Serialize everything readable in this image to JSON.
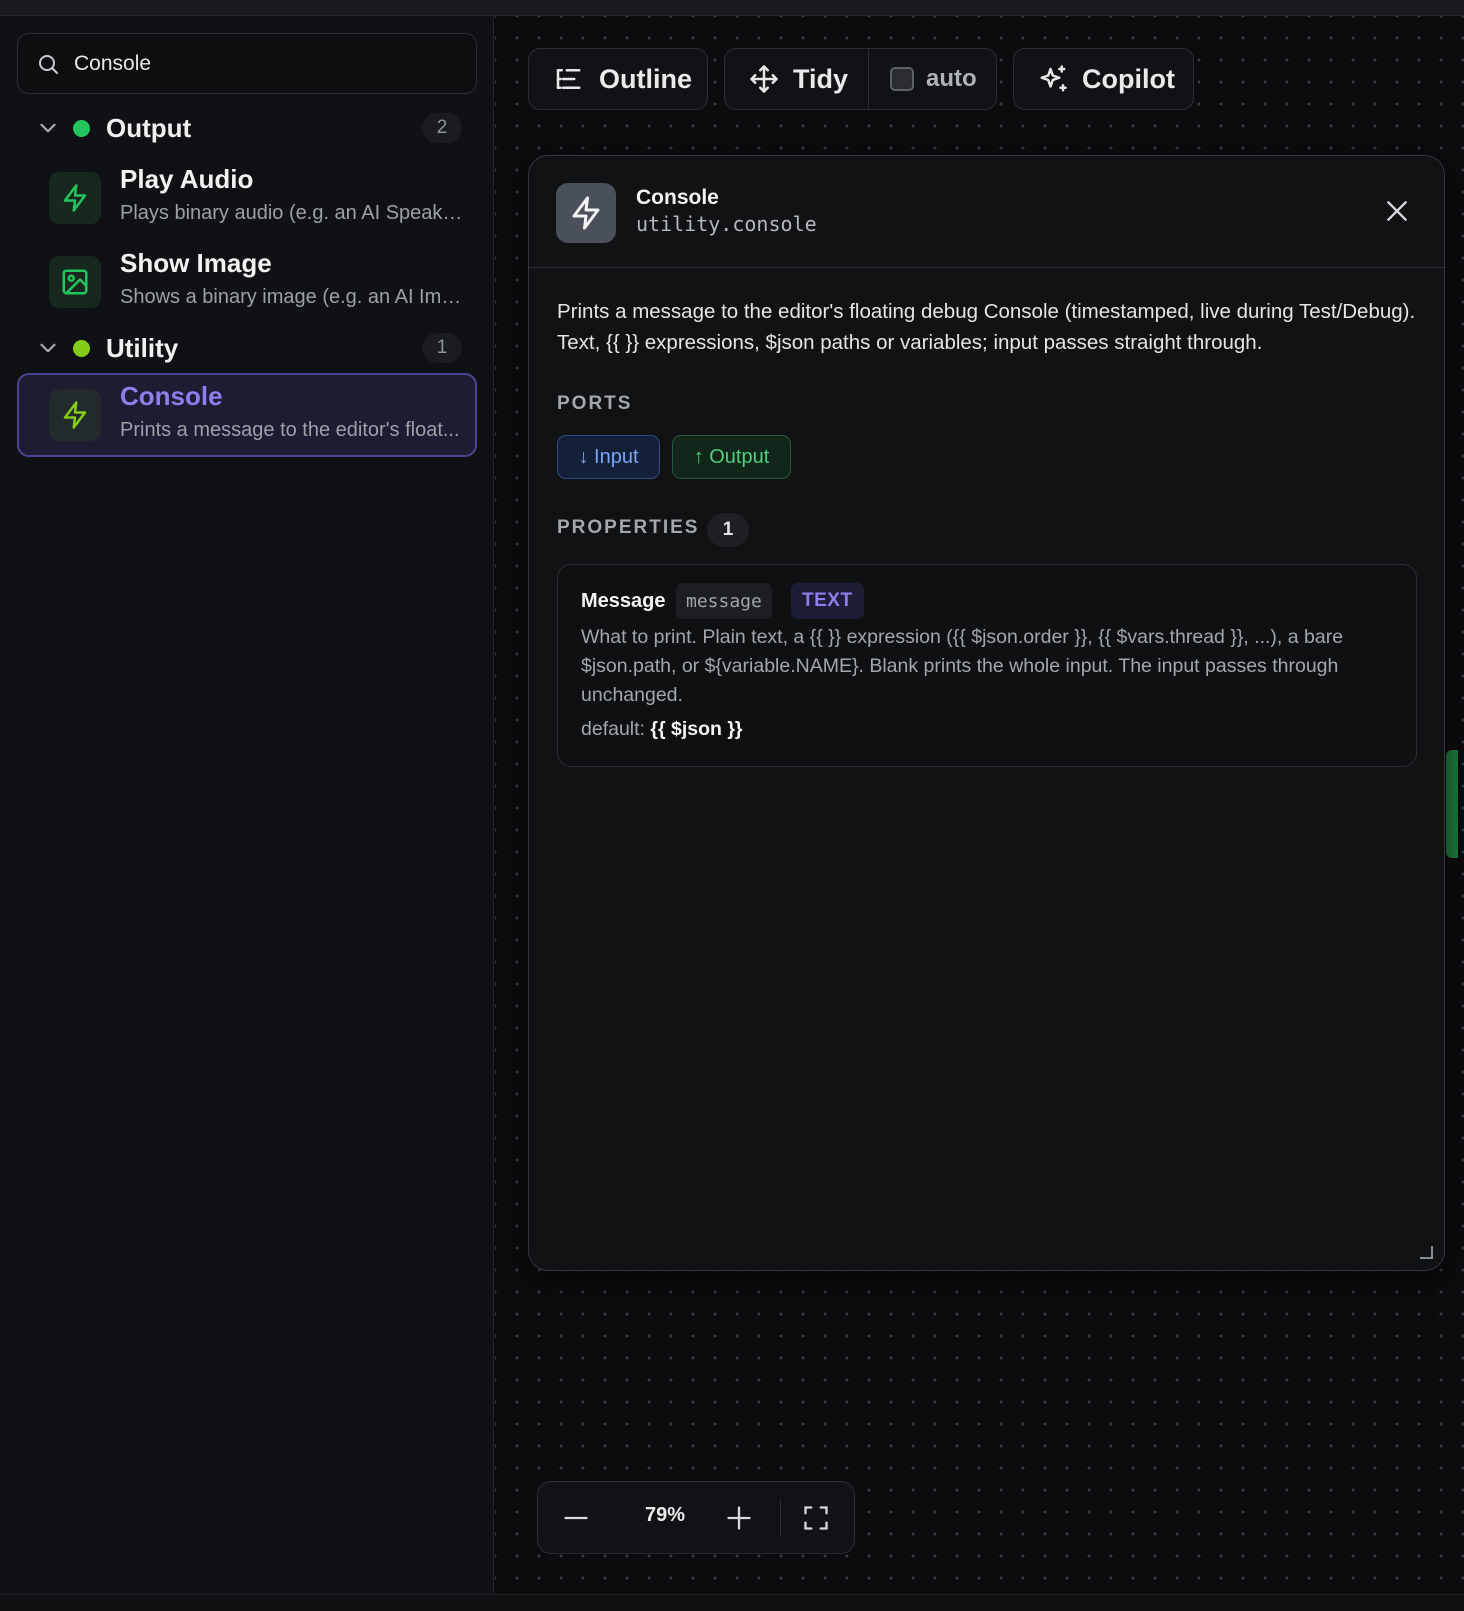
{
  "search": {
    "value": "Console"
  },
  "sidebar": {
    "groups": [
      {
        "name": "Output",
        "count": "2",
        "color": "#22c55e"
      },
      {
        "name": "Utility",
        "count": "1",
        "color": "#84cc16"
      }
    ],
    "items": [
      {
        "title": "Play Audio",
        "desc": "Plays binary audio (e.g. an AI Speak r...",
        "icon": "lightning-icon"
      },
      {
        "title": "Show Image",
        "desc": "Shows a binary image (e.g. an AI Ima...",
        "icon": "image-icon"
      },
      {
        "title": "Console",
        "desc": "Prints a message to the editor's float...",
        "icon": "lightning-icon",
        "selected": true
      }
    ]
  },
  "toolbar": {
    "outline": "Outline",
    "tidy": "Tidy",
    "auto": "auto",
    "auto_checked": false,
    "copilot": "Copilot"
  },
  "panel": {
    "title": "Console",
    "type": "utility.console",
    "description": "Prints a message to the editor's floating debug Console (timestamped, live during Test/Debug). Text, {{ }} expressions, $json paths or variables; input passes straight through.",
    "ports_label": "PORTS",
    "ports": {
      "input": "↓ Input",
      "output": "↑ Output"
    },
    "properties_label": "PROPERTIES",
    "properties_count": "1",
    "property": {
      "name": "Message",
      "key": "message",
      "type": "TEXT",
      "description": "What to print. Plain text, a {{ }} expression ({{ $json.order }}, {{ $vars.thread }}, ...), a bare $json.path, or ${variable.NAME}. Blank prints the whole input. The input passes through unchanged.",
      "default_label": "default:",
      "default_value": "{{ $json }}"
    }
  },
  "zoom": {
    "value": "79%"
  },
  "colors": {
    "accent": "#8b7ff0",
    "success": "#22c55e",
    "input_port": "#78a7f5"
  }
}
